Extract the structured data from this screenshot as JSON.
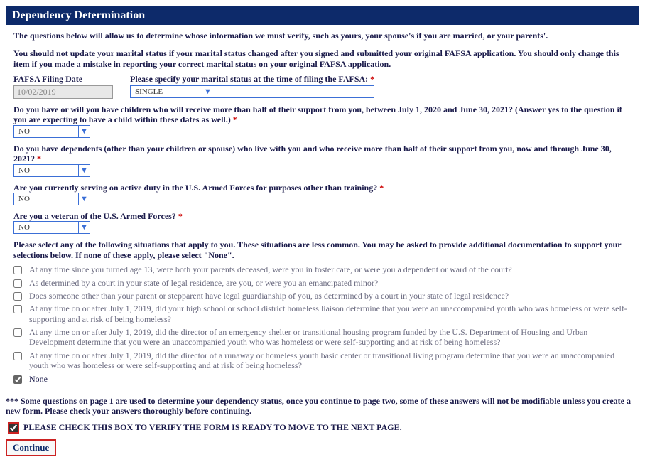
{
  "header": {
    "title": "Dependency Determination"
  },
  "intro": "The questions below will allow us to determine whose information we must verify, such as yours, your spouse's if you are married, or your parents'.",
  "warn1": "You should not update your marital status if your marital status changed after you signed and submitted your original FAFSA application. You should only change this item if you made a mistake in reporting your correct marital status on your original FAFSA application.",
  "filing": {
    "date_label": "FAFSA Filing Date",
    "date_value": "10/02/2019",
    "marital_label": "Please specify your marital status at the time of filing the FAFSA:",
    "marital_value": "SINGLE"
  },
  "q_children": "Do you have or will you have children who will receive more than half of their support from you, between July 1, 2020 and June 30, 2021? (Answer yes to the question if you are expecting to have a child within these dates as well.)",
  "q_children_value": "NO",
  "q_dependents": "Do you have dependents (other than your children or spouse) who live with you and who receive more than half of their support from you, now and through June 30, 2021?",
  "q_dependents_value": "NO",
  "q_activeduty": "Are you currently serving on active duty in the U.S. Armed Forces for purposes other than training?",
  "q_activeduty_value": "NO",
  "q_veteran": "Are you a veteran of the U.S. Armed Forces?",
  "q_veteran_value": "NO",
  "situations_intro": "Please select any of the following situations that apply to you. These situations are less common. You may be asked to provide additional documentation to support your selections below. If none of these apply, please select \"None\".",
  "situations": [
    "At any time since you turned age 13, were both your parents deceased, were you in foster care, or were you a dependent or ward of the court?",
    "As determined by a court in your state of legal residence, are you, or were you an emancipated minor?",
    "Does someone other than your parent or stepparent have legal guardianship of you, as determined by a court in your state of legal residence?",
    "At any time on or after July 1, 2019, did your high school or school district homeless liaison determine that you were an unaccompanied youth who was homeless or were self-supporting and at risk of being homeless?",
    "At any time on or after July 1, 2019, did the director of an emergency shelter or transitional housing program funded by the U.S. Department of Housing and Urban Development determine that you were an unaccompanied youth who was homeless or were self-supporting and at risk of being homeless?",
    "At any time on or after July 1, 2019, did the director of a runaway or homeless youth basic center or transitional living program determine that you were an unaccompanied youth who was homeless or were self-supporting and at risk of being homeless?",
    "None"
  ],
  "situations_checked": [
    false,
    false,
    false,
    false,
    false,
    false,
    true
  ],
  "footnote": "*** Some questions on page 1 are used to determine your dependency status, once you continue to page two, some of these answers will not be modifiable unless you create a new form. Please check your answers thoroughly before continuing.",
  "verify_label": "PLEASE CHECK THIS BOX TO VERIFY THE FORM IS READY TO MOVE TO THE NEXT PAGE.",
  "verify_checked": true,
  "continue_label": "Continue",
  "required_marker": "*"
}
